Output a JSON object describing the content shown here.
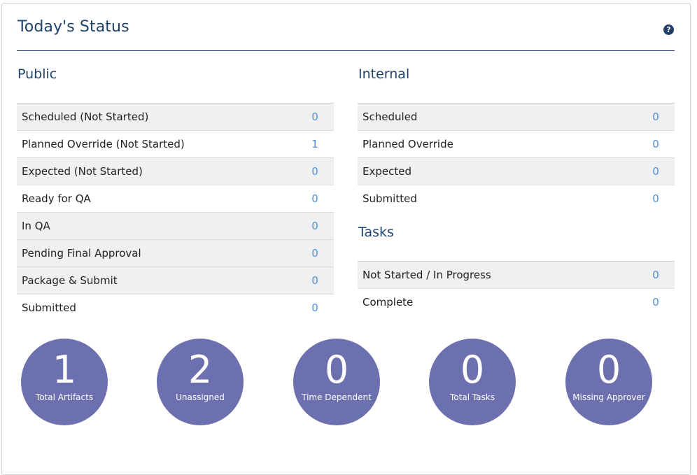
{
  "header": {
    "title": "Today's Status",
    "help_glyph": "?"
  },
  "public": {
    "heading": "Public",
    "rows": [
      {
        "label": "Scheduled (Not Started)",
        "value": "0"
      },
      {
        "label": "Planned Override (Not Started)",
        "value": "1"
      },
      {
        "label": "Expected (Not Started)",
        "value": "0"
      },
      {
        "label": "Ready for QA",
        "value": "0"
      },
      {
        "label": "In QA",
        "value": "0"
      },
      {
        "label": "Pending Final Approval",
        "value": "0"
      },
      {
        "label": "Package & Submit",
        "value": "0"
      },
      {
        "label": "Submitted",
        "value": "0"
      }
    ]
  },
  "internal": {
    "heading": "Internal",
    "rows": [
      {
        "label": "Scheduled",
        "value": "0"
      },
      {
        "label": "Planned Override",
        "value": "0"
      },
      {
        "label": "Expected",
        "value": "0"
      },
      {
        "label": "Submitted",
        "value": "0"
      }
    ]
  },
  "tasks": {
    "heading": "Tasks",
    "rows": [
      {
        "label": "Not Started / In Progress",
        "value": "0"
      },
      {
        "label": "Complete",
        "value": "0"
      }
    ]
  },
  "summary": [
    {
      "number": "1",
      "label": "Total Artifacts"
    },
    {
      "number": "2",
      "label": "Unassigned"
    },
    {
      "number": "0",
      "label": "Time Dependent"
    },
    {
      "number": "0",
      "label": "Total Tasks"
    },
    {
      "number": "0",
      "label": "Missing Approver"
    }
  ],
  "colors": {
    "heading": "#20436b",
    "link": "#4a90d9",
    "circle": "#6c70ae",
    "row_alt": "#f0f0f0"
  }
}
